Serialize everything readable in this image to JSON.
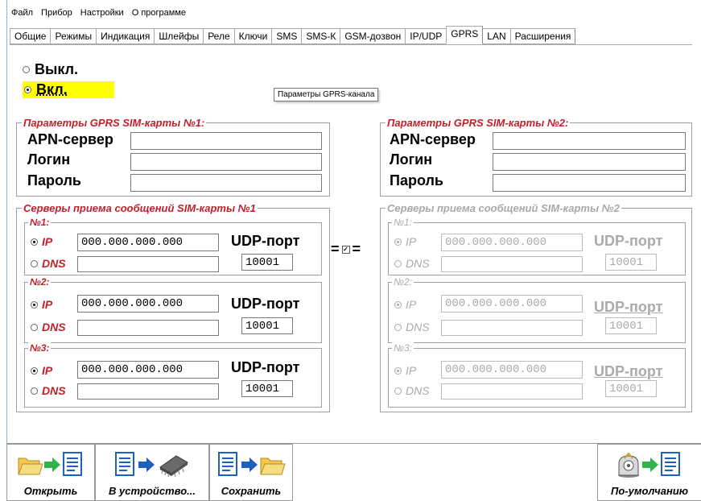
{
  "menu": [
    "Файл",
    "Прибор",
    "Настройки",
    "О программе"
  ],
  "tabs": [
    "Общие",
    "Режимы",
    "Индикация",
    "Шлейфы",
    "Реле",
    "Ключи",
    "SMS",
    "SMS-К",
    "GSM-дозвон",
    "IP/UDP",
    "GPRS",
    "LAN",
    "Расширения"
  ],
  "active_tab": "GPRS",
  "mode": {
    "off_label": "Выкл.",
    "on_label": "Вкл.",
    "selected": "Вкл.",
    "highlight_color": "#ffff00"
  },
  "tooltip": "Параметры GPRS-канала",
  "sim1": {
    "title": "Параметры GPRS SIM-карты №1:",
    "apn_label": "APN-сервер",
    "login_label": "Логин",
    "password_label": "Пароль",
    "apn_value": "",
    "login_value": "",
    "password_value": ""
  },
  "sim2": {
    "title": "Параметры GPRS SIM-карты №2:",
    "apn_label": "APN-сервер",
    "login_label": "Логин",
    "password_label": "Пароль",
    "apn_value": "",
    "login_value": "",
    "password_value": ""
  },
  "servers1": {
    "title": "Серверы приема сообщений SIM-карты №1",
    "servers": [
      {
        "title": "№1:",
        "ip_label": "IP",
        "dns_label": "DNS",
        "ip": "000.000.000.000",
        "dns": "",
        "udp_label": "UDP-порт",
        "port": "10001",
        "mode": "IP"
      },
      {
        "title": "№2:",
        "ip_label": "IP",
        "dns_label": "DNS",
        "ip": "000.000.000.000",
        "dns": "",
        "udp_label": "UDP-порт",
        "port": "10001",
        "mode": "IP"
      },
      {
        "title": "№3:",
        "ip_label": "IP",
        "dns_label": "DNS",
        "ip": "000.000.000.000",
        "dns": "",
        "udp_label": "UDP-порт",
        "port": "10001",
        "mode": "IP"
      }
    ]
  },
  "servers2": {
    "title": "Серверы приема сообщений SIM-карты №2",
    "disabled": true,
    "servers": [
      {
        "title": "№1:",
        "ip_label": "IP",
        "dns_label": "DNS",
        "ip": "000.000.000.000",
        "dns": "",
        "udp_label": "UDP-порт",
        "port": "10001",
        "mode": "IP"
      },
      {
        "title": "№2:",
        "ip_label": "IP",
        "dns_label": "DNS",
        "ip": "000.000.000.000",
        "dns": "",
        "udp_label": "UDP-порт",
        "port": "10001",
        "mode": "IP"
      },
      {
        "title": "№3:",
        "ip_label": "IP",
        "dns_label": "DNS",
        "ip": "000.000.000.000",
        "dns": "",
        "udp_label": "UDP-порт",
        "port": "10001",
        "mode": "IP"
      }
    ]
  },
  "same_servers": {
    "checked": true,
    "symbol": "="
  },
  "toolbar": {
    "open_label": "Открыть",
    "to_device_label": "В устройство...",
    "save_label": "Сохранить",
    "defaults_label": "По-умолчанию"
  },
  "colors": {
    "accent_red": "#c0202a",
    "disabled_gray": "#aaaaaa",
    "arrow_blue": "#1f5fbf",
    "arrow_green": "#2fb34a",
    "folder_yellow": "#f2c94c"
  }
}
